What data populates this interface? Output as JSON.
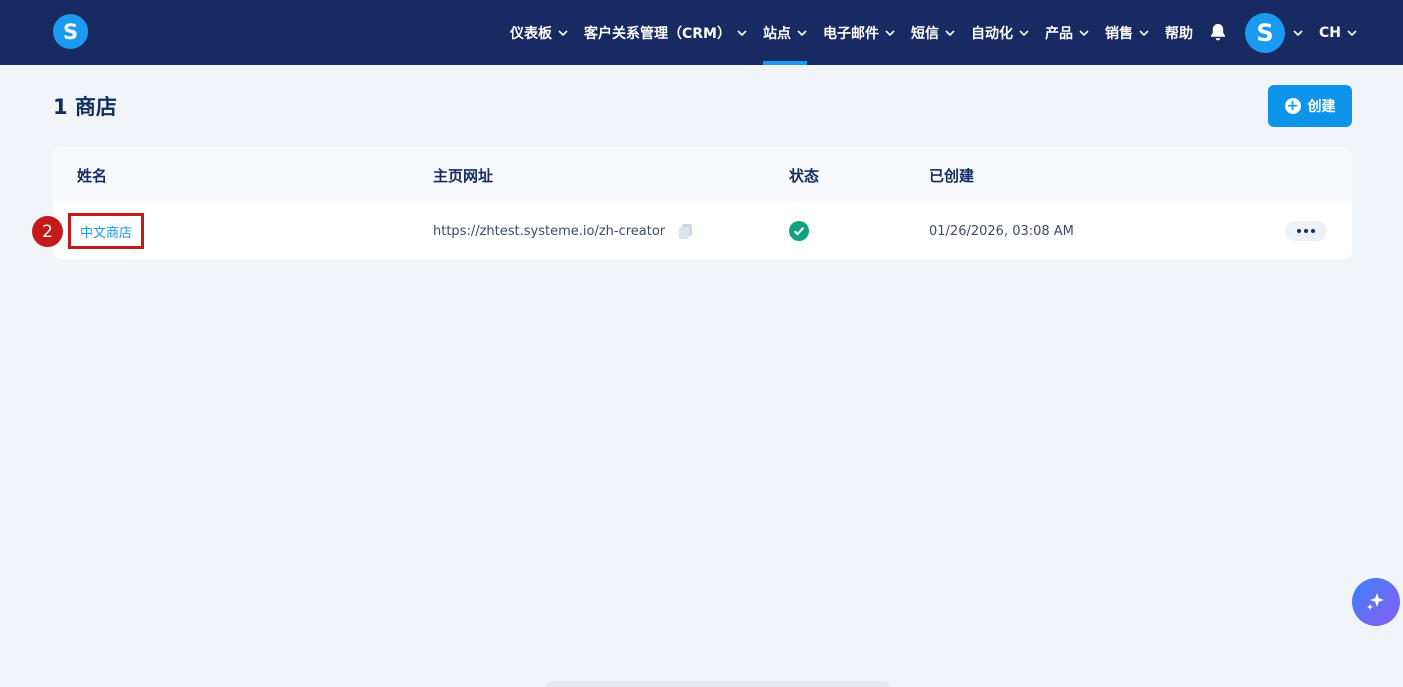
{
  "header": {
    "logo_letter": "S",
    "nav": [
      {
        "label": "仪表板",
        "chevron": true,
        "active": false
      },
      {
        "label": "客户关系管理（CRM）",
        "chevron": true,
        "active": false
      },
      {
        "label": "站点",
        "chevron": true,
        "active": true
      },
      {
        "label": "电子邮件",
        "chevron": true,
        "active": false
      },
      {
        "label": "短信",
        "chevron": true,
        "active": false
      },
      {
        "label": "自动化",
        "chevron": true,
        "active": false
      },
      {
        "label": "产品",
        "chevron": true,
        "active": false
      },
      {
        "label": "销售",
        "chevron": true,
        "active": false
      },
      {
        "label": "帮助",
        "chevron": false,
        "active": false
      }
    ],
    "avatar_letter": "S",
    "language": "CH"
  },
  "page": {
    "title": "1 商店",
    "create_label": "创建"
  },
  "table": {
    "columns": [
      "姓名",
      "主页网址",
      "状态",
      "已创建"
    ],
    "rows": [
      {
        "name": "中文商店",
        "url": "https://zhtest.systeme.io/zh-creator",
        "status": "active",
        "created": "01/26/2026, 03:08 AM"
      }
    ]
  },
  "annotation": {
    "step_number": "2"
  },
  "colors": {
    "topbar": "#172a62",
    "accent": "#1a9af0",
    "button": "#0d93e9",
    "status_ok": "#10a37f",
    "highlight": "#c41a1a",
    "background": "#f1f4f9"
  }
}
